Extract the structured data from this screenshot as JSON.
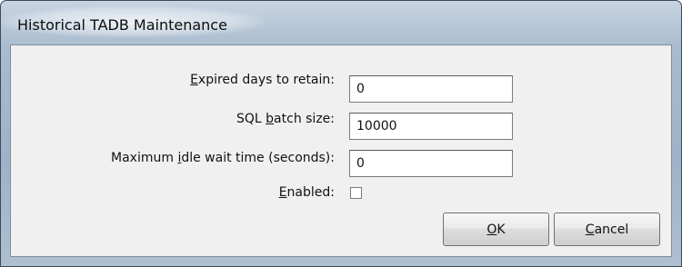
{
  "window": {
    "title": "Historical TADB Maintenance"
  },
  "form": {
    "expired_days": {
      "label_accel": "E",
      "label_rest": "xpired days to retain:",
      "value": "0"
    },
    "sql_batch": {
      "label_pre": "SQL ",
      "label_accel": "b",
      "label_rest": "atch size:",
      "value": "10000"
    },
    "idle_wait": {
      "label_pre": "Maximum ",
      "label_accel": "i",
      "label_rest": "dle wait time (seconds):",
      "value": "0"
    },
    "enabled": {
      "label_accel": "E",
      "label_rest": "nabled:",
      "checked": false
    }
  },
  "buttons": {
    "ok": {
      "label_accel": "O",
      "label_rest": "K"
    },
    "cancel": {
      "label_accel": "C",
      "label_rest": "ancel"
    }
  }
}
